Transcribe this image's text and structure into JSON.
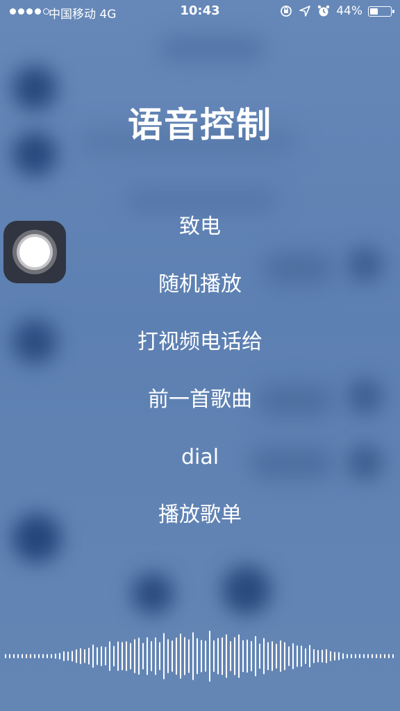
{
  "status_bar": {
    "carrier": "中国移动",
    "network": "4G",
    "time": "10:43",
    "battery_percent": "44%",
    "battery_level": 0.44,
    "signal_dots_filled": 4,
    "icons": [
      "orientation-lock-icon",
      "location-icon",
      "alarm-icon",
      "battery-icon"
    ]
  },
  "title": "语音控制",
  "suggestions": [
    "致电",
    "随机播放",
    "打视频电话给",
    "前一首歌曲",
    "dial",
    "播放歌单"
  ],
  "assistive_touch": {
    "icon": "assistive-touch-icon"
  },
  "waveform": {
    "icon": "voice-waveform-icon"
  },
  "colors": {
    "background": "#5f82b4",
    "text": "#ffffff",
    "blur_dark": "#2b4a7a"
  }
}
